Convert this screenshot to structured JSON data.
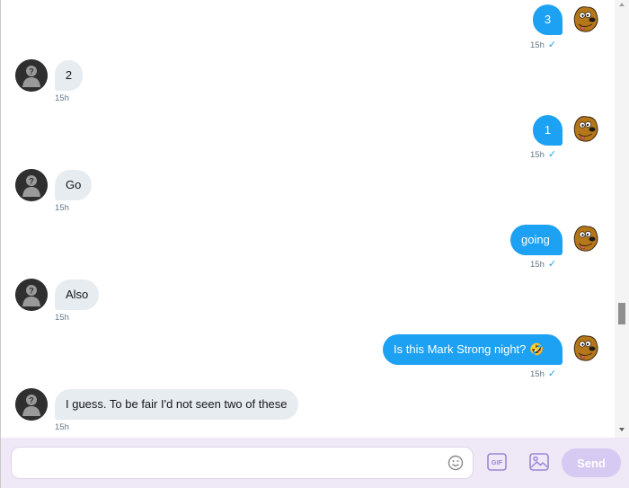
{
  "messages": [
    {
      "id": "m1",
      "direction": "sent",
      "text": "3",
      "time": "15h"
    },
    {
      "id": "m2",
      "direction": "received",
      "text": "2",
      "time": "15h"
    },
    {
      "id": "m3",
      "direction": "sent",
      "text": "1",
      "time": "15h"
    },
    {
      "id": "m4",
      "direction": "received",
      "text": "Go",
      "time": "15h"
    },
    {
      "id": "m5",
      "direction": "sent",
      "text": "going",
      "time": "15h"
    },
    {
      "id": "m6",
      "direction": "received",
      "text": "Also",
      "time": "15h"
    },
    {
      "id": "m7",
      "direction": "sent",
      "text": "Is this Mark Strong night? 🤣",
      "time": "15h"
    },
    {
      "id": "m8",
      "direction": "received",
      "text": "I guess. To be fair I'd not seen two of these",
      "time": "15h"
    }
  ],
  "status": {
    "read_icon": "checkmark-icon"
  },
  "composer": {
    "placeholder": "",
    "value": "",
    "emoji_icon": "emoji-icon",
    "gif_label": "GIF",
    "image_icon": "image-icon",
    "send_label": "Send"
  },
  "colors": {
    "sent_bubble": "#1da1f2",
    "received_bubble": "#e6ecf0",
    "composer_bg": "#efe8f6",
    "send_button": "#d6c9f2",
    "accent_purple": "#9b86d6"
  }
}
